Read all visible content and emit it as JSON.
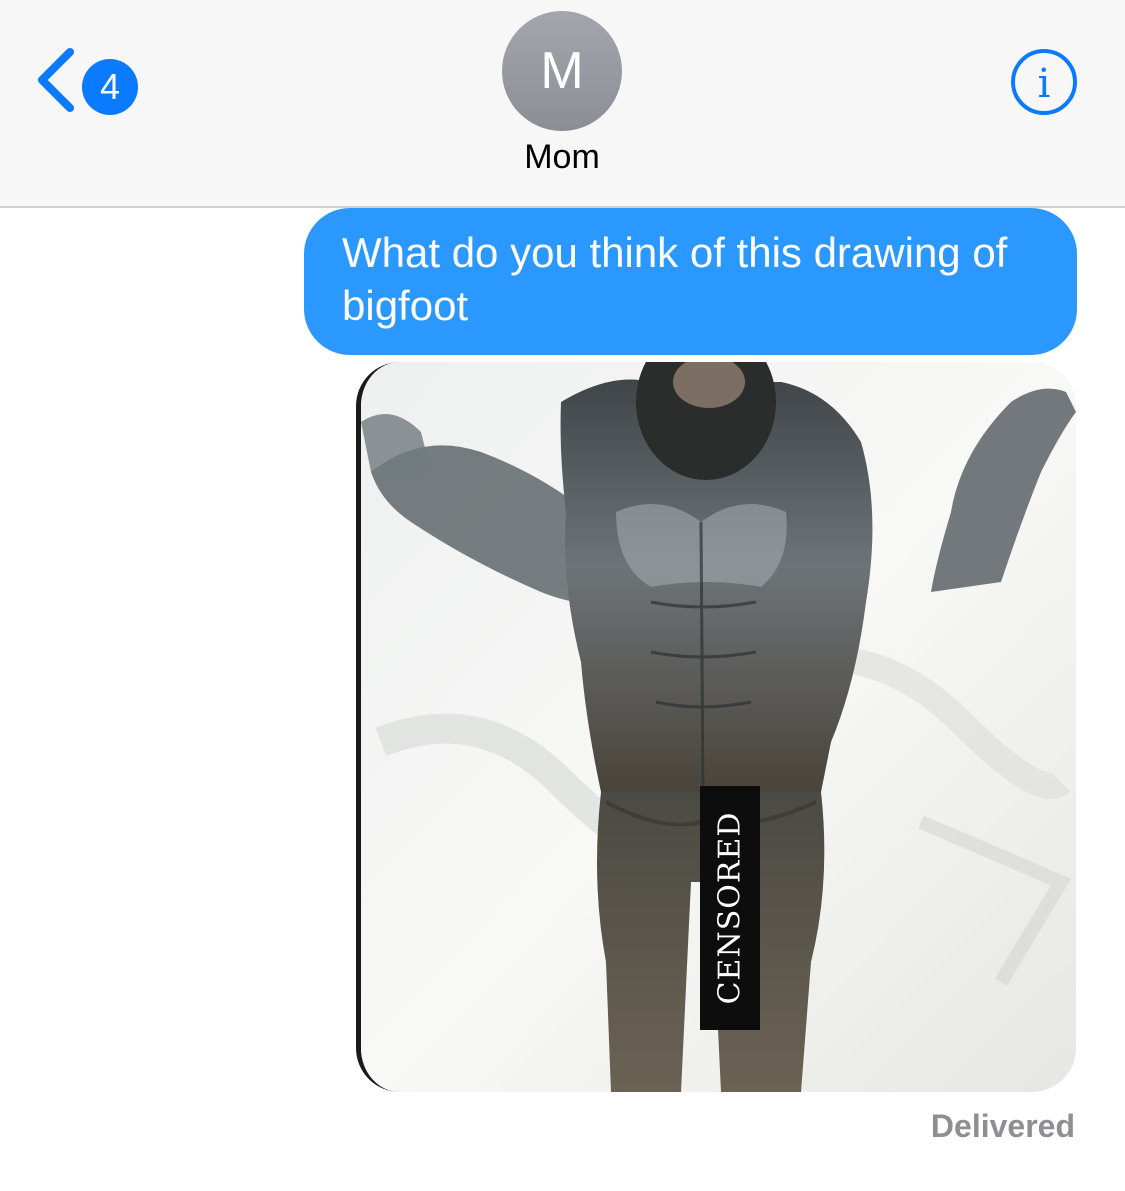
{
  "header": {
    "back": {
      "icon": "chevron-left-icon",
      "unread_count": "4"
    },
    "contact": {
      "avatar_initial": "M",
      "name": "Mom"
    },
    "info_icon": "info-icon",
    "accent_color": "#0a7aff"
  },
  "conversation": {
    "messages": [
      {
        "direction": "outgoing",
        "text": "What do you think of this drawing of bigfoot",
        "bubble_color": "#2b98ff"
      },
      {
        "direction": "outgoing",
        "type": "image",
        "overlay_text": "CENSORED"
      }
    ],
    "status": "Delivered"
  }
}
